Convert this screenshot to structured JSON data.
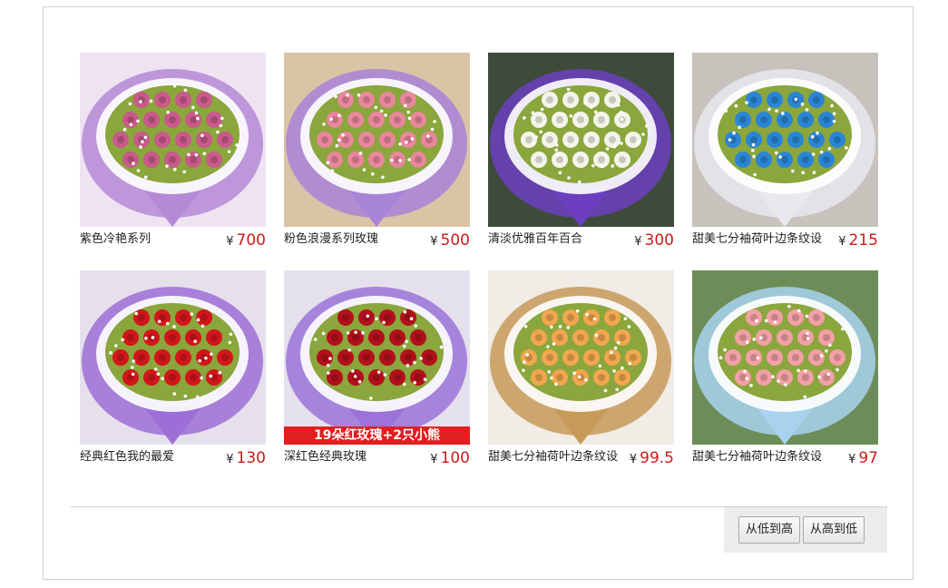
{
  "currency_symbol": "¥",
  "products": [
    {
      "name": "紫色冷艳系列",
      "price": "700",
      "image": "purple-pink-rose-bouquet",
      "flower_color": "#c95a8a",
      "wrap_color": "#b48ad6",
      "bg_color": "#efe3f2"
    },
    {
      "name": "粉色浪漫系列玫瑰",
      "price": "500",
      "image": "pink-carnation-bouquet",
      "flower_color": "#e9879c",
      "wrap_color": "#a884d8",
      "bg_color": "#d9c4a6"
    },
    {
      "name": "清淡优雅百年百合",
      "price": "300",
      "image": "white-lily-bouquet",
      "flower_color": "#f4f4ea",
      "wrap_color": "#6b3fbf",
      "bg_color": "#3e4b3a"
    },
    {
      "name": "甜美七分袖荷叶边条纹设",
      "price": "215",
      "image": "blue-rose-bear-bouquet",
      "flower_color": "#2a86d4",
      "wrap_color": "#e8e8ee",
      "bg_color": "#c8c2bc"
    },
    {
      "name": "经典红色我的最爱",
      "price": "130",
      "image": "red-rose-bear-bouquet",
      "flower_color": "#d2161b",
      "wrap_color": "#9c6fd6",
      "bg_color": "#e6e0ec"
    },
    {
      "name": "深红色经典玫瑰",
      "price": "100",
      "image": "deep-red-rose-bouquet",
      "flower_color": "#b3101c",
      "wrap_color": "#9b73d9",
      "bg_color": "#e4e0ec",
      "banner": "19朵红玫瑰+2只小熊"
    },
    {
      "name": "甜美七分袖荷叶边条纹设",
      "price": "99.5",
      "image": "orange-rose-bouquet",
      "flower_color": "#f1a64f",
      "wrap_color": "#c79a5a",
      "bg_color": "#f1ece5"
    },
    {
      "name": "甜美七分袖荷叶边条纹设",
      "price": "97",
      "image": "pink-rose-blue-wrap-bouquet",
      "flower_color": "#f2a0a6",
      "wrap_color": "#a8d2ee",
      "bg_color": "#6c8d58"
    }
  ],
  "sort": {
    "low_to_high": "从低到高",
    "high_to_low": "从高到低"
  }
}
